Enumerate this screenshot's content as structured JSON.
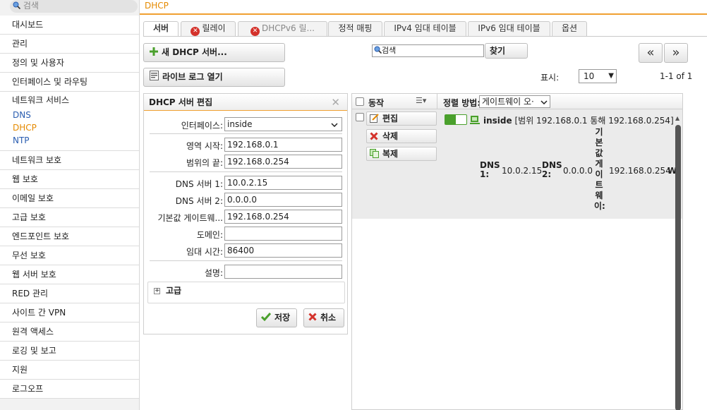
{
  "sidebar": {
    "search_placeholder": "검색",
    "items": [
      "대시보드",
      "관리",
      "정의 및 사용자",
      "인터페이스 및 라우팅"
    ],
    "network_services": {
      "label": "네트워크 서비스",
      "subs": [
        "DNS",
        "DHCP",
        "NTP"
      ]
    },
    "items2": [
      "네트워크 보호",
      "웹 보호",
      "이메일 보호",
      "고급 보호",
      "엔드포인트 보호",
      "무선 보호",
      "웹 서버 보호",
      "RED 관리",
      "사이트 간 VPN",
      "원격 액세스",
      "로깅 및 보고",
      "지원",
      "로그오프"
    ]
  },
  "header": {
    "title": "DHCP"
  },
  "tabs": [
    "서버",
    "릴레이",
    "DHCPv6 릴...",
    "정적 매핑",
    "IPv4 임대 테이블",
    "IPv6 임대 테이블",
    "옵션"
  ],
  "toolbar": {
    "new_server_label": "새 DHCP 서버...",
    "live_log_label": "라이브 로그 열기",
    "search_value": "검색",
    "find_label": "찾기",
    "prev_label": "«",
    "next_label": "»",
    "show_label": "표시:",
    "page_size": "10",
    "range": "1-1 of 1"
  },
  "edit": {
    "title": "DHCP 서버 편집",
    "close": "✕",
    "fields": {
      "interface": {
        "label": "인터페이스:",
        "value": "inside"
      },
      "range_start": {
        "label": "영역 시작:",
        "value": "192.168.0.1"
      },
      "range_end": {
        "label": "범위의 끝:",
        "value": "192.168.0.254"
      },
      "dns1": {
        "label": "DNS 서버 1:",
        "value": "10.0.2.15"
      },
      "dns2": {
        "label": "DNS 서버 2:",
        "value": "0.0.0.0"
      },
      "gateway": {
        "label": "기본값 게이트웨...",
        "value": "192.168.0.254"
      },
      "domain": {
        "label": "도메인:",
        "value": ""
      },
      "lease": {
        "label": "임대 시간:",
        "value": "86400"
      },
      "comment": {
        "label": "설명:",
        "value": ""
      }
    },
    "advanced_label": "고급",
    "advanced_expander": "+",
    "save_label": "저장",
    "cancel_label": "취소"
  },
  "list": {
    "action_header": "동작",
    "sort_label": "정렬 방법:",
    "sort_value": "게이트웨이 오·",
    "edit_label": "편집",
    "delete_label": "삭제",
    "copy_label": "복제",
    "entry_name": "inside",
    "entry_range": "[범위 192.168.0.1 통해 192.168.0.254]",
    "dns1_label": "DNS 1:",
    "dns1_value": "10.0.2.15",
    "dns2_label": "DNS 2:",
    "dns2_value": "0.0.0.0",
    "gateway_label": "기본값게이트웨이:",
    "gateway_value": "192.168.0.254",
    "truncated": "W"
  },
  "colors": {
    "accent": "#f0a030",
    "link": "#2a5db0",
    "active": "#e58a00",
    "green": "#4aa02c",
    "red": "#d4322b"
  }
}
